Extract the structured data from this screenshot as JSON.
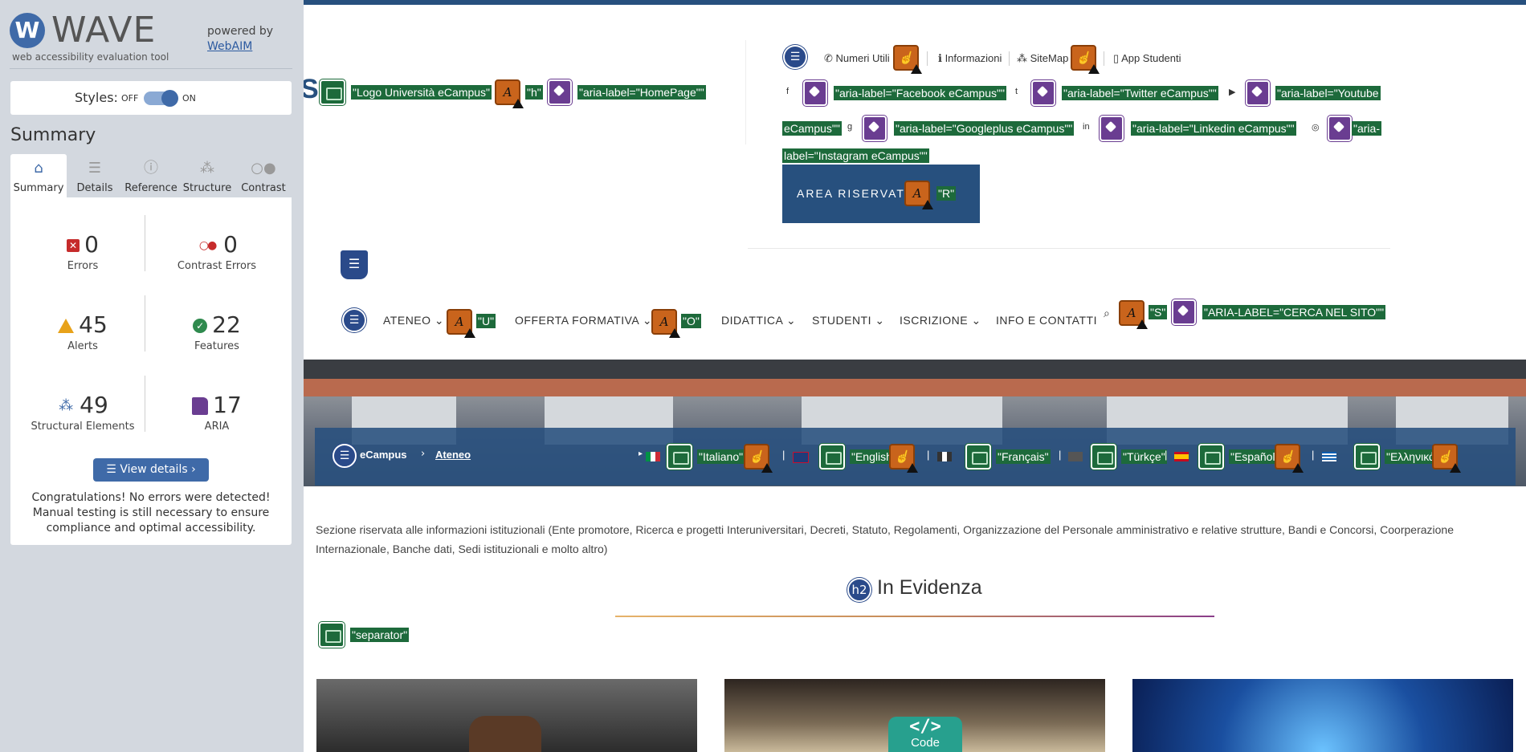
{
  "wave": {
    "logo_letter": "W",
    "logo_word": "WAVE",
    "tagline": "web accessibility evaluation tool",
    "powered_by": "powered by",
    "webaim": "WebAIM",
    "styles_label": "Styles:",
    "off_label": "OFF",
    "on_label": "ON",
    "summary_title": "Summary",
    "tabs": [
      {
        "label": "Summary",
        "icon": "home-icon"
      },
      {
        "label": "Details",
        "icon": "list-icon"
      },
      {
        "label": "Reference",
        "icon": "info-icon"
      },
      {
        "label": "Structure",
        "icon": "structure-icon"
      },
      {
        "label": "Contrast",
        "icon": "contrast-icon"
      }
    ],
    "stats": {
      "errors": {
        "value": "0",
        "label": "Errors"
      },
      "contrast": {
        "value": "0",
        "label": "Contrast Errors"
      },
      "alerts": {
        "value": "45",
        "label": "Alerts"
      },
      "features": {
        "value": "22",
        "label": "Features"
      },
      "structure": {
        "value": "49",
        "label": "Structural Elements"
      },
      "aria": {
        "value": "17",
        "label": "ARIA"
      }
    },
    "view_details": "View details ›",
    "congrats": "Congratulations! No errors were detected! Manual testing is still necessary to ensure compliance and optimal accessibility."
  },
  "site": {
    "logo_alt": "\"Logo Università eCampus\"",
    "logo_h": "\"h\"",
    "logo_aria": "\"aria-label=\"HomePage\"\"",
    "top_links": {
      "numeri": "Numeri Utili",
      "info": "Informazioni",
      "sitemap": "SiteMap",
      "app": "App Studenti"
    },
    "social": {
      "facebook": "\"aria-label=\"Facebook eCampus\"\"",
      "twitter": "\"aria-label=\"Twitter eCampus\"\"",
      "youtube_1": "\"aria-label=\"Youtube",
      "youtube_2": "eCampus\"\"",
      "google": "\"aria-label=\"Googleplus eCampus\"\"",
      "linkedin": "\"aria-label=\"Linkedin eCampus\"\"",
      "instagram_1": "\"aria-",
      "instagram_2": "label=\"Instagram eCampus\"\""
    },
    "area_riservata": "AREA RISERVATA",
    "area_r": "\"R\"",
    "nav": {
      "ateneo": "ATENEO",
      "ateneo_u": "\"U\"",
      "offerta": "OFFERTA FORMATIVA",
      "offerta_o": "\"O\"",
      "didattica": "DIDATTICA",
      "studenti": "STUDENTI",
      "iscrizione": "ISCRIZIONE",
      "info": "INFO E CONTATTI",
      "search_s": "\"S\"",
      "search_aria": "\"ARIA-LABEL=\"CERCA NEL SITO\"\""
    },
    "breadcrumb": {
      "home": "eCampus",
      "current": "Ateneo"
    },
    "languages": [
      "\"Italiano\"",
      "\"English\"",
      "\"Français\"",
      "\"Türkçe\"",
      "\"Español\"",
      "\"Ελληνικά\""
    ],
    "description": "Sezione riservata alle informazioni istituzionali (Ente promotore, Ricerca e progetti Interuniversitari, Decreti, Statuto, Regolamenti, Organizzazione del Personale amministrativo e relative strutture, Bandi e Concorsi, Coorperazione Internazionale, Banche dati, Sedi istituzionali e molto altro)",
    "h2_badge": "h2",
    "h2_title": "In Evidenza",
    "separator": "\"separator\"",
    "code_label": "Code",
    "code_icon": "</>"
  }
}
